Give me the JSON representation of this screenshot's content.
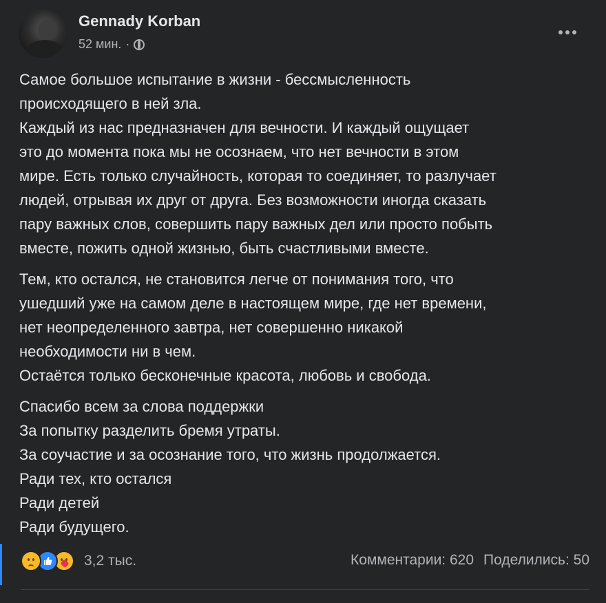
{
  "post": {
    "author": "Gennady Korban",
    "time": "52 мин.",
    "separator": "·",
    "privacy_icon": "globe-icon",
    "more_icon": "more-options-icon",
    "paragraphs": [
      {
        "lines": [
          "Самое большое испытание в жизни - бессмысленность",
          "происходящего в ней зла.",
          "Каждый из нас предназначен для вечности. И каждый ощущает",
          "это до момента пока мы не осознаем, что нет вечности в этом",
          "мире. Есть только случайность, которая то соединяет, то разлучает",
          "людей, отрывая их друг от друга. Без возможности иногда сказать",
          "пару важных слов, совершить пару важных дел или просто побыть",
          "вместе, пожить одной жизнью, быть счастливыми вместе."
        ]
      },
      {
        "lines": [
          "Тем, кто остался, не становится легче от понимания того, что",
          "ушедший уже на самом деле в настоящем мире, где нет времени,",
          "нет неопределенного завтра, нет совершенно никакой",
          "необходимости ни в чем.",
          "Остаётся только бесконечные красота, любовь и свобода."
        ]
      },
      {
        "lines": [
          "Спасибо всем за слова поддержки",
          "За попытку разделить бремя утраты.",
          "За соучастие и за осознание того, что жизнь продолжается.",
          "Ради тех, кто остался",
          "Ради детей",
          "Ради будущего."
        ]
      }
    ],
    "reactions": {
      "icons": [
        "sad-icon",
        "like-icon",
        "care-icon"
      ],
      "count": "3,2 тыс."
    },
    "comments": "Комментарии: 620",
    "shares": "Поделились: 50"
  },
  "colors": {
    "background": "#242526",
    "text_primary": "#e4e6eb",
    "text_secondary": "#b0b3b8",
    "accent": "#2d88ff"
  }
}
